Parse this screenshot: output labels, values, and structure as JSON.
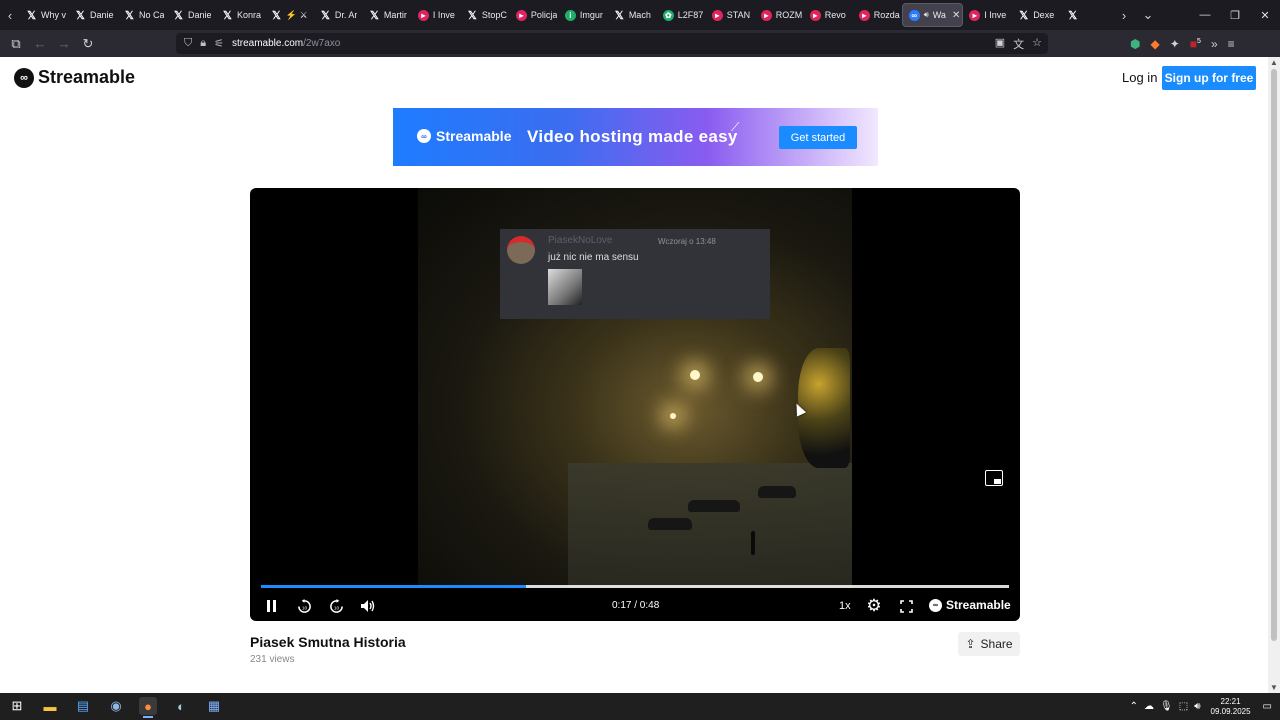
{
  "browser": {
    "tabs": [
      {
        "label": "Why v",
        "icon": "x-icon"
      },
      {
        "label": "Danie",
        "icon": "x-icon"
      },
      {
        "label": "No Ca",
        "icon": "x-icon"
      },
      {
        "label": "Danie",
        "icon": "x-icon"
      },
      {
        "label": "Konra",
        "icon": "x-icon"
      },
      {
        "label": "⚡ ⚔",
        "icon": "x-icon"
      },
      {
        "label": "Dr. Ar",
        "icon": "x-icon"
      },
      {
        "label": "Martir",
        "icon": "x-icon"
      },
      {
        "label": "I Inve",
        "icon": "youtube-icon"
      },
      {
        "label": "StopC",
        "icon": "x-icon"
      },
      {
        "label": "Policja",
        "icon": "youtube-icon"
      },
      {
        "label": "Imgur",
        "icon": "imgur-icon"
      },
      {
        "label": "Mach",
        "icon": "x-icon"
      },
      {
        "label": "L2F87",
        "icon": "leaf-icon"
      },
      {
        "label": "STAN",
        "icon": "youtube-icon"
      },
      {
        "label": "ROZM",
        "icon": "youtube-icon"
      },
      {
        "label": "Revo",
        "icon": "youtube-icon"
      },
      {
        "label": "Rozda",
        "icon": "youtube-icon"
      },
      {
        "label": "Wa",
        "icon": "streamable-icon",
        "active": true
      },
      {
        "label": "I Inve",
        "icon": "youtube-icon"
      },
      {
        "label": "Dexe",
        "icon": "x-icon"
      },
      {
        "label": "",
        "icon": "x-icon"
      }
    ],
    "url_host": "streamable.com",
    "url_path": "/2w7axo",
    "extension_badge": "5"
  },
  "site": {
    "logo_text": "Streamable",
    "login_label": "Log in",
    "signup_label": "Sign up for free"
  },
  "banner": {
    "logo_text": "Streamable",
    "tagline": "Video hosting made easy",
    "cta_label": "Get started"
  },
  "video_frame": {
    "chat_user": "PiasekNoLove",
    "chat_time": "Wczoraj o 13:48",
    "chat_message": "już nic nie ma sensu"
  },
  "player": {
    "progress": 0.3542,
    "time": "0:17 / 0:48",
    "speed": "1x",
    "brand": "Streamable",
    "rewind_label": "10",
    "forward_label": "10"
  },
  "video": {
    "title": "Piasek Smutna Historia",
    "views": "231 views",
    "share_label": "Share"
  },
  "taskbar": {
    "time": "22:21",
    "date": "09.09.2025"
  },
  "colors": {
    "accent": "#1a8cff",
    "chrome_dark": "#1c1b22",
    "toolbar": "#2b2a33"
  }
}
